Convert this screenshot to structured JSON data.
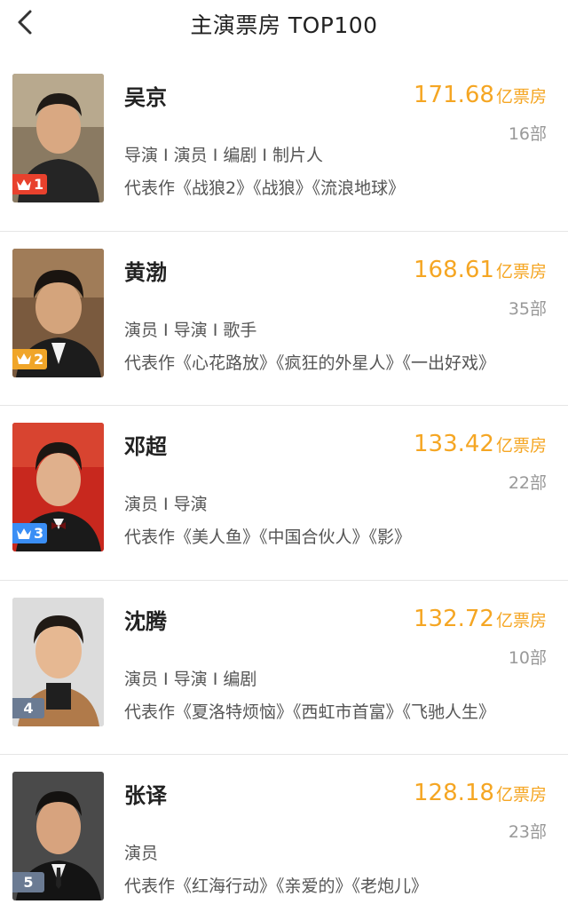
{
  "header": {
    "title": "主演票房 TOP100"
  },
  "unit_label": "亿票房",
  "colors": {
    "accent": "#f5a623",
    "rank1": "#e8412d",
    "rank2": "#f0a528",
    "rank3": "#3a8ef5",
    "rank_other": "#6b7b93"
  },
  "items": [
    {
      "rank": "1",
      "name": "吴京",
      "amount": "171.68",
      "count": "16部",
      "roles": "导演 I 演员 I 编剧 I 制片人",
      "works": "代表作《战狼2》《战狼》《流浪地球》"
    },
    {
      "rank": "2",
      "name": "黄渤",
      "amount": "168.61",
      "count": "35部",
      "roles": "演员 I 导演 I 歌手",
      "works": "代表作《心花路放》《疯狂的外星人》《一出好戏》"
    },
    {
      "rank": "3",
      "name": "邓超",
      "amount": "133.42",
      "count": "22部",
      "roles": "演员 I 导演",
      "works": "代表作《美人鱼》《中国合伙人》《影》"
    },
    {
      "rank": "4",
      "name": "沈腾",
      "amount": "132.72",
      "count": "10部",
      "roles": "演员 I 导演 I 编剧",
      "works": "代表作《夏洛特烦恼》《西虹市首富》《飞驰人生》"
    },
    {
      "rank": "5",
      "name": "张译",
      "amount": "128.18",
      "count": "23部",
      "roles": "演员",
      "works": "代表作《红海行动》《亲爱的》《老炮儿》"
    }
  ]
}
